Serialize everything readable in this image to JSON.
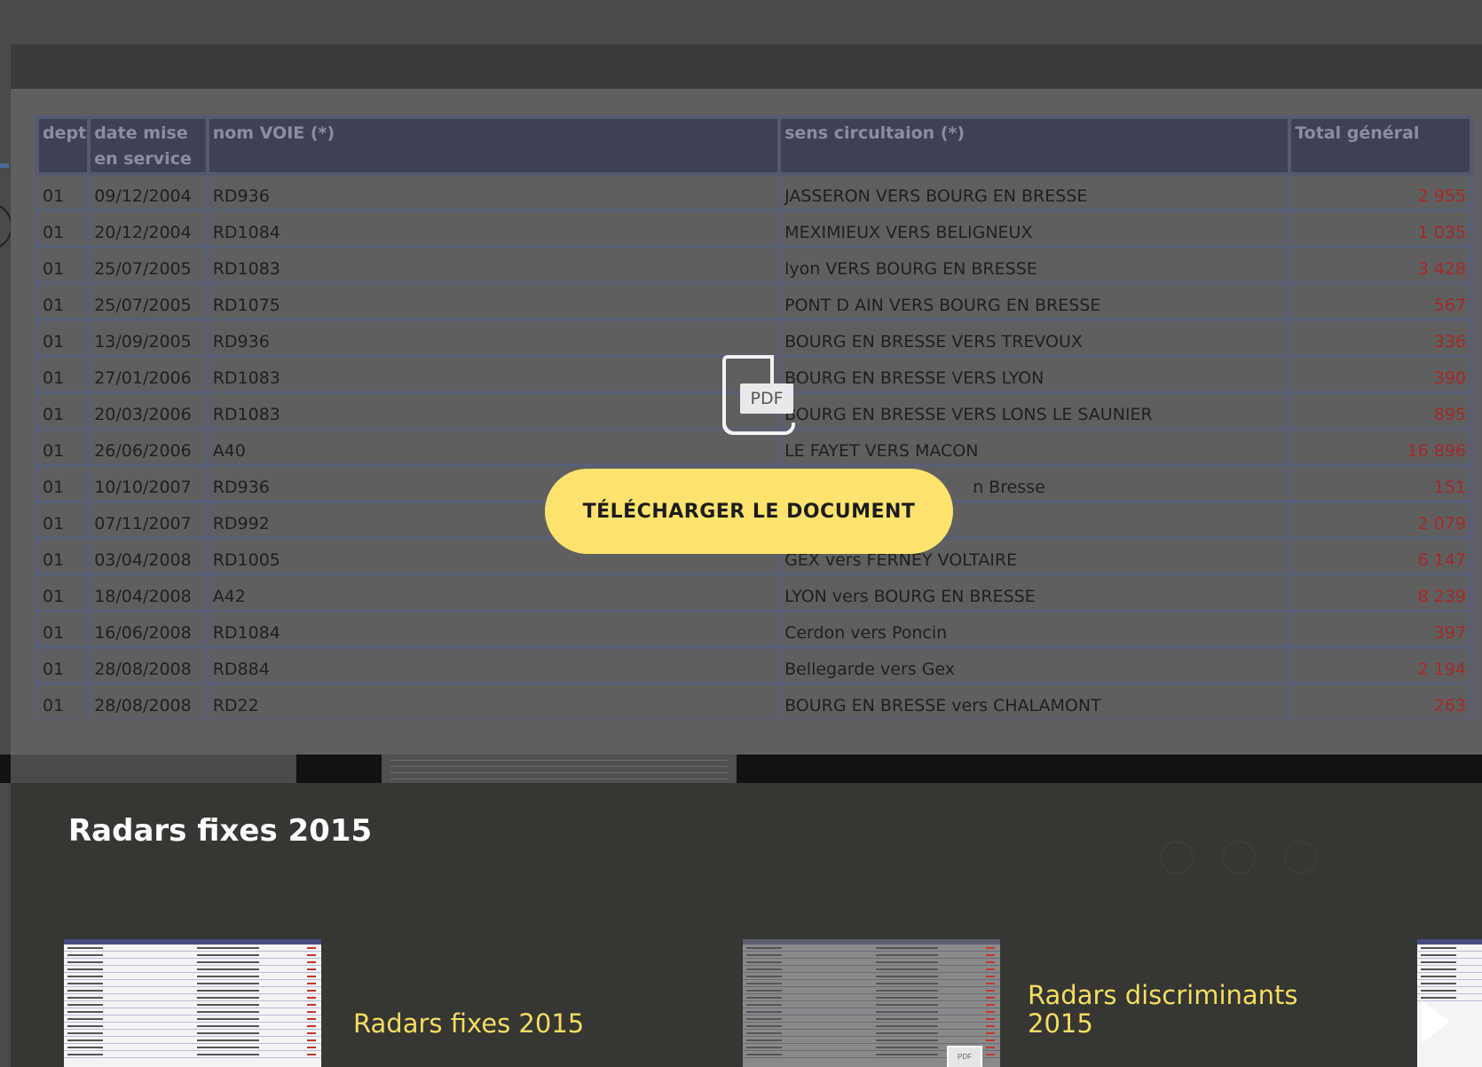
{
  "document": {
    "headers": [
      "dept",
      "date mise en service",
      "nom VOIE (*)",
      "sens circultaion (*)",
      "Total général"
    ],
    "rows": [
      [
        "01",
        "09/12/2004",
        "RD936",
        "JASSERON VERS BOURG EN BRESSE",
        "2 955"
      ],
      [
        "01",
        "20/12/2004",
        "RD1084",
        "MEXIMIEUX VERS BELIGNEUX",
        "1 035"
      ],
      [
        "01",
        "25/07/2005",
        "RD1083",
        "lyon VERS BOURG EN BRESSE",
        "3 428"
      ],
      [
        "01",
        "25/07/2005",
        "RD1075",
        "PONT D AIN VERS BOURG EN BRESSE",
        "567"
      ],
      [
        "01",
        "13/09/2005",
        "RD936",
        "BOURG EN BRESSE VERS TREVOUX",
        "336"
      ],
      [
        "01",
        "27/01/2006",
        "RD1083",
        "BOURG EN BRESSE VERS LYON",
        "390"
      ],
      [
        "01",
        "20/03/2006",
        "RD1083",
        "BOURG EN BRESSE VERS LONS LE SAUNIER",
        "895"
      ],
      [
        "01",
        "26/06/2006",
        "A40",
        "LE FAYET VERS MACON",
        "16 896"
      ],
      [
        "01",
        "10/10/2007",
        "RD936",
        "n Bresse",
        "151"
      ],
      [
        "01",
        "07/11/2007",
        "RD992",
        "",
        "2 079"
      ],
      [
        "01",
        "03/04/2008",
        "RD1005",
        "GEX vers FERNEY VOLTAIRE",
        "6 147"
      ],
      [
        "01",
        "18/04/2008",
        "A42",
        "LYON vers BOURG EN BRESSE",
        "8 239"
      ],
      [
        "01",
        "16/06/2008",
        "RD1084",
        "Cerdon vers Poncin",
        "397"
      ],
      [
        "01",
        "28/08/2008",
        "RD884",
        "Bellegarde vers Gex",
        "2 194"
      ],
      [
        "01",
        "28/08/2008",
        "RD22",
        "BOURG EN BRESSE vers CHALAMONT",
        "263"
      ]
    ]
  },
  "overlay": {
    "pdf_label": "PDF",
    "download_label": "TÉLÉCHARGER LE DOCUMENT"
  },
  "panel": {
    "title": "Radars fixes 2015",
    "related": [
      {
        "title": "Radars fixes 2015"
      },
      {
        "title_line1": "Radars discriminants",
        "title_line2": "2015",
        "pdf_label": "PDF"
      }
    ]
  },
  "icons": [
    "pdf-icon",
    "facebook-icon",
    "twitter-icon",
    "email-icon",
    "next-arrow-icon"
  ],
  "colors": {
    "accent_yellow": "#fde36d",
    "title_yellow": "#f5dd62",
    "panel_bg": "#363632",
    "value_red": "#a02a2a"
  }
}
